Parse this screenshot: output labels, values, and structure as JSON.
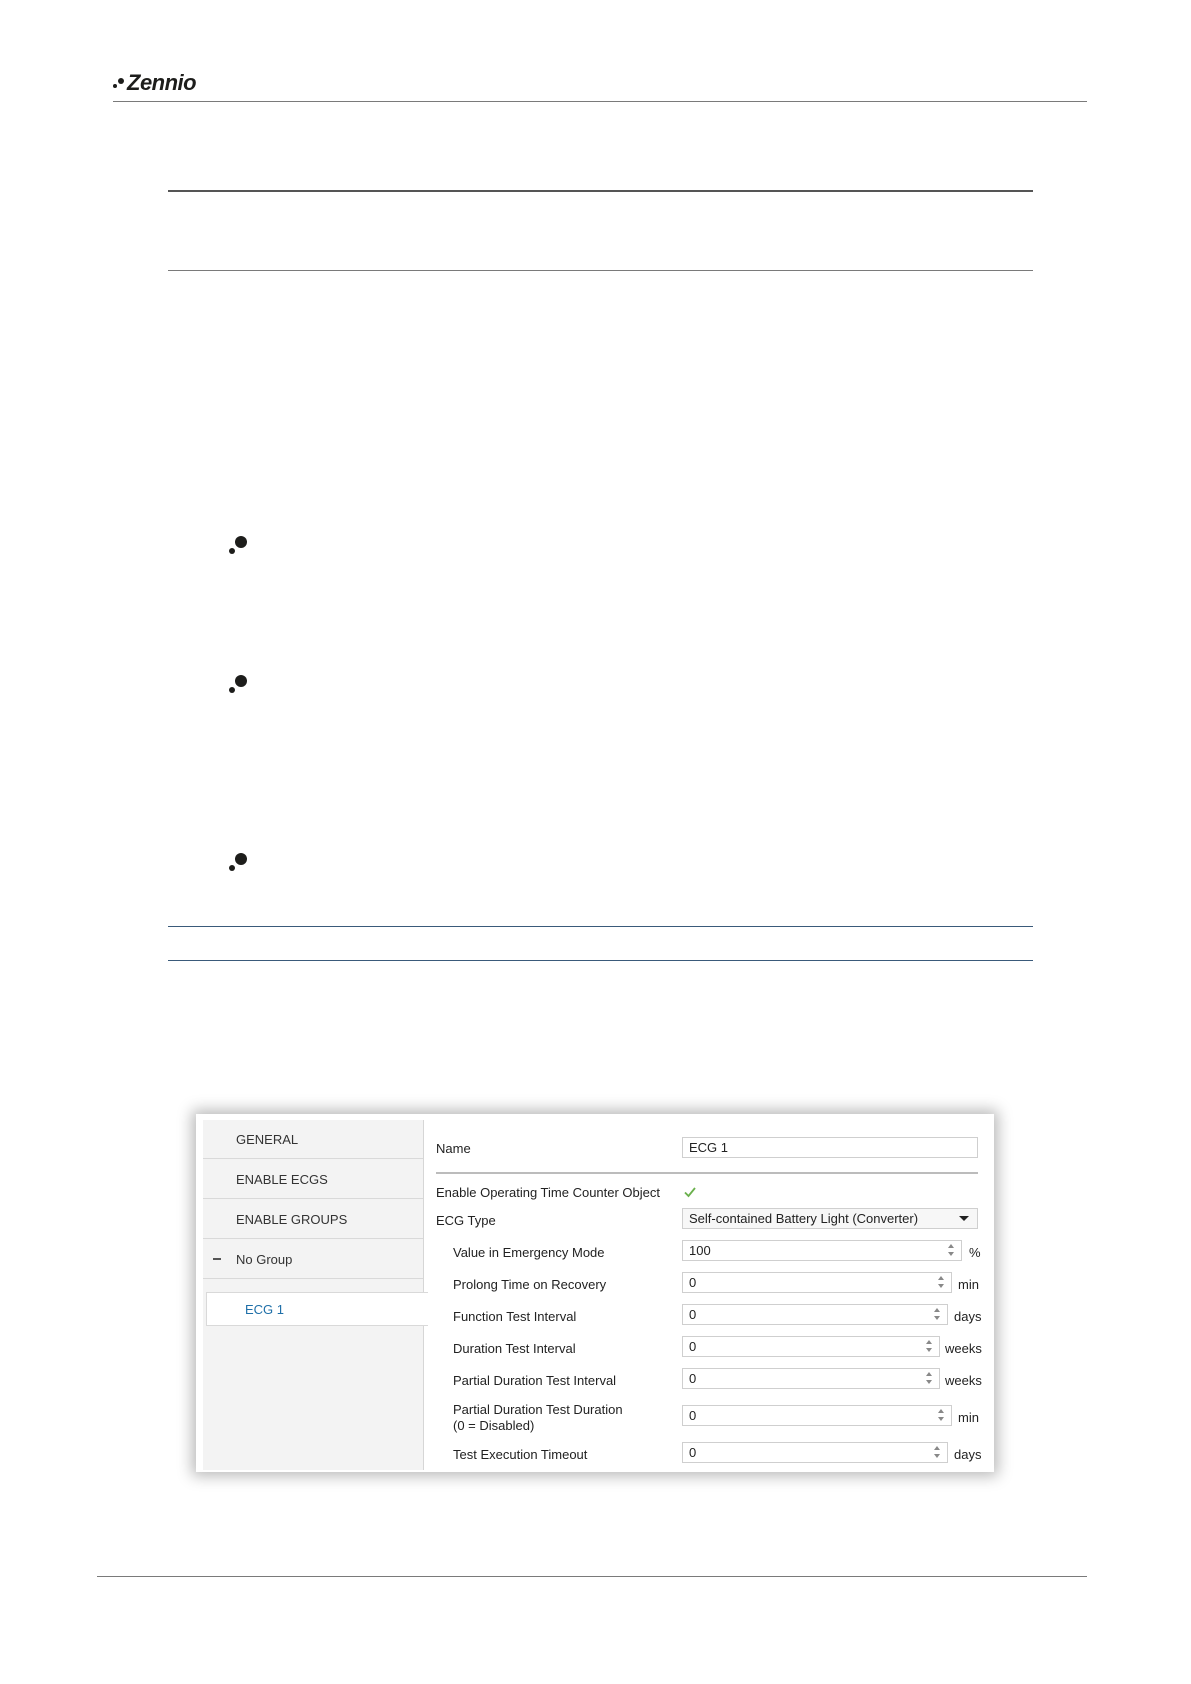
{
  "header": {
    "logo_text": "Zennio"
  },
  "screenshot": {
    "sidebar": {
      "items": [
        {
          "label": "GENERAL"
        },
        {
          "label": "ENABLE ECGS"
        },
        {
          "label": "ENABLE GROUPS"
        },
        {
          "label": "No Group"
        },
        {
          "label": "ECG 1"
        }
      ]
    },
    "params": {
      "name": {
        "label": "Name",
        "value": "ECG 1"
      },
      "operating_counter": {
        "label": "Enable Operating Time Counter Object",
        "checked": true
      },
      "ecg_type": {
        "label": "ECG Type",
        "value": "Self-contained Battery Light (Converter)"
      },
      "emergency_value": {
        "label": "Value in Emergency Mode",
        "value": "100",
        "unit": "%"
      },
      "prolong_time": {
        "label": "Prolong Time on Recovery",
        "value": "0",
        "unit": "min"
      },
      "function_test": {
        "label": "Function Test Interval",
        "value": "0",
        "unit": "days"
      },
      "duration_test": {
        "label": "Duration Test Interval",
        "value": "0",
        "unit": "weeks"
      },
      "partial_interval": {
        "label": "Partial Duration Test Interval",
        "value": "0",
        "unit": "weeks"
      },
      "partial_duration": {
        "label_line1": "Partial Duration Test Duration",
        "label_line2": "(0 = Disabled)",
        "value": "0",
        "unit": "min"
      },
      "timeout": {
        "label": "Test Execution Timeout",
        "value": "0",
        "unit": "days"
      }
    }
  },
  "colors": {
    "accent": "#1e6fa8",
    "check": "#6ab04c"
  }
}
